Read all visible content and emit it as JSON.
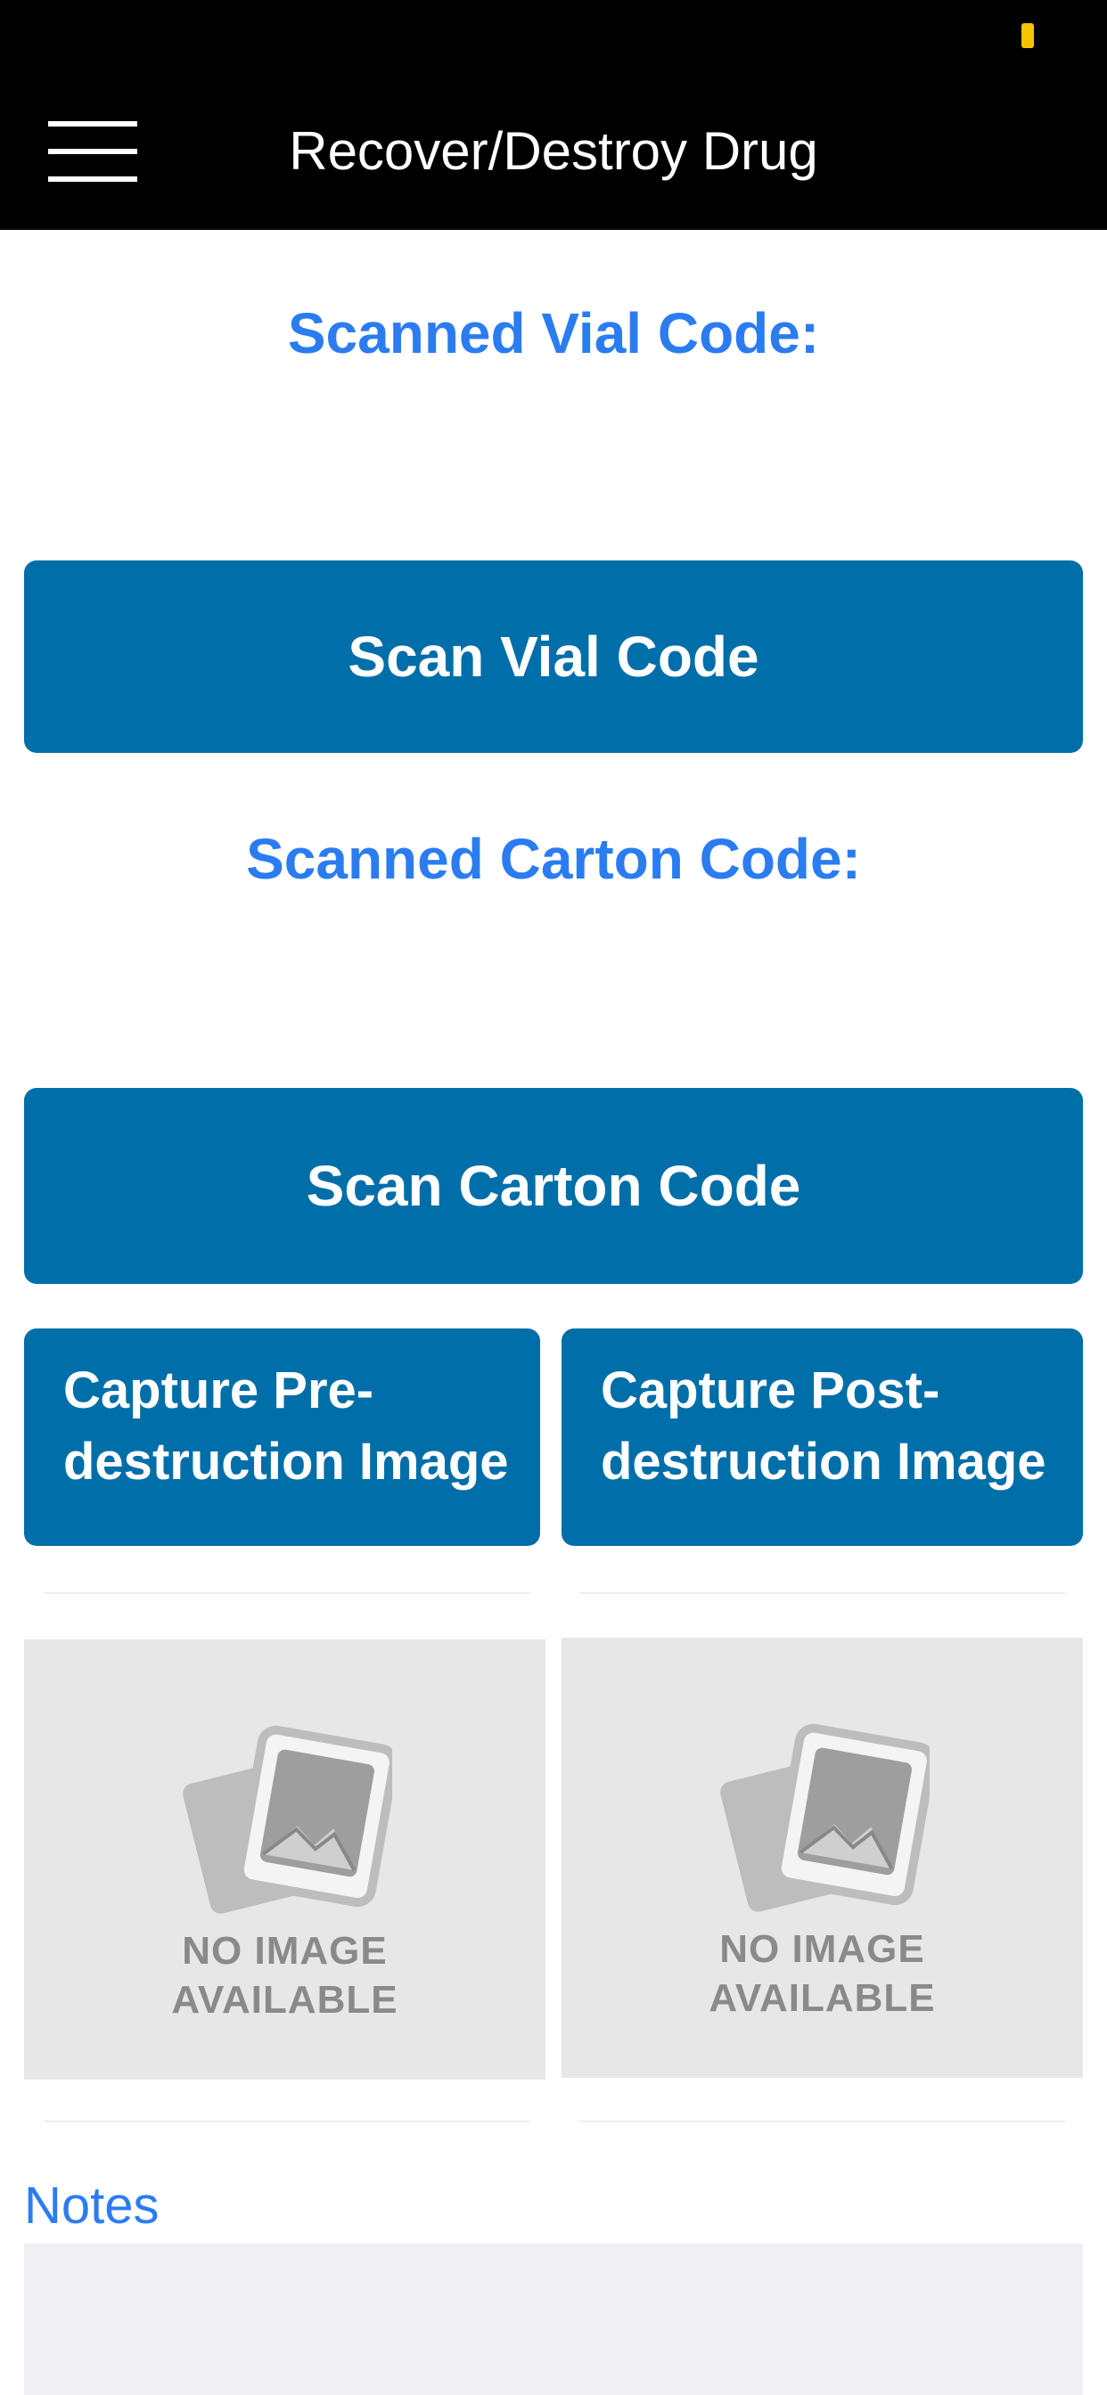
{
  "header": {
    "title": "Recover/Destroy Drug",
    "menu_icon": "hamburger-menu-icon",
    "battery_color": "#f7c400"
  },
  "vial": {
    "label": "Scanned Vial Code:",
    "value": "",
    "button_label": "Scan Vial Code"
  },
  "carton": {
    "label": "Scanned Carton Code:",
    "value": "",
    "button_label": "Scan Carton Code"
  },
  "capture": {
    "pre_label": "Capture Pre-\ndestruction Image",
    "post_label": "Capture Post-\ndestruction Image"
  },
  "images": {
    "pre_placeholder": "NO IMAGE\nAVAILABLE",
    "post_placeholder": "NO IMAGE\nAVAILABLE",
    "placeholder_icon": "no-image-icon"
  },
  "notes": {
    "label": "Notes",
    "value": "",
    "placeholder": ""
  },
  "colors": {
    "header_bg": "#000000",
    "accent_blue": "#2b7cf0",
    "button_blue": "#006ea8",
    "placeholder_bg": "#e7e7e7",
    "notes_bg": "#efeff4"
  }
}
